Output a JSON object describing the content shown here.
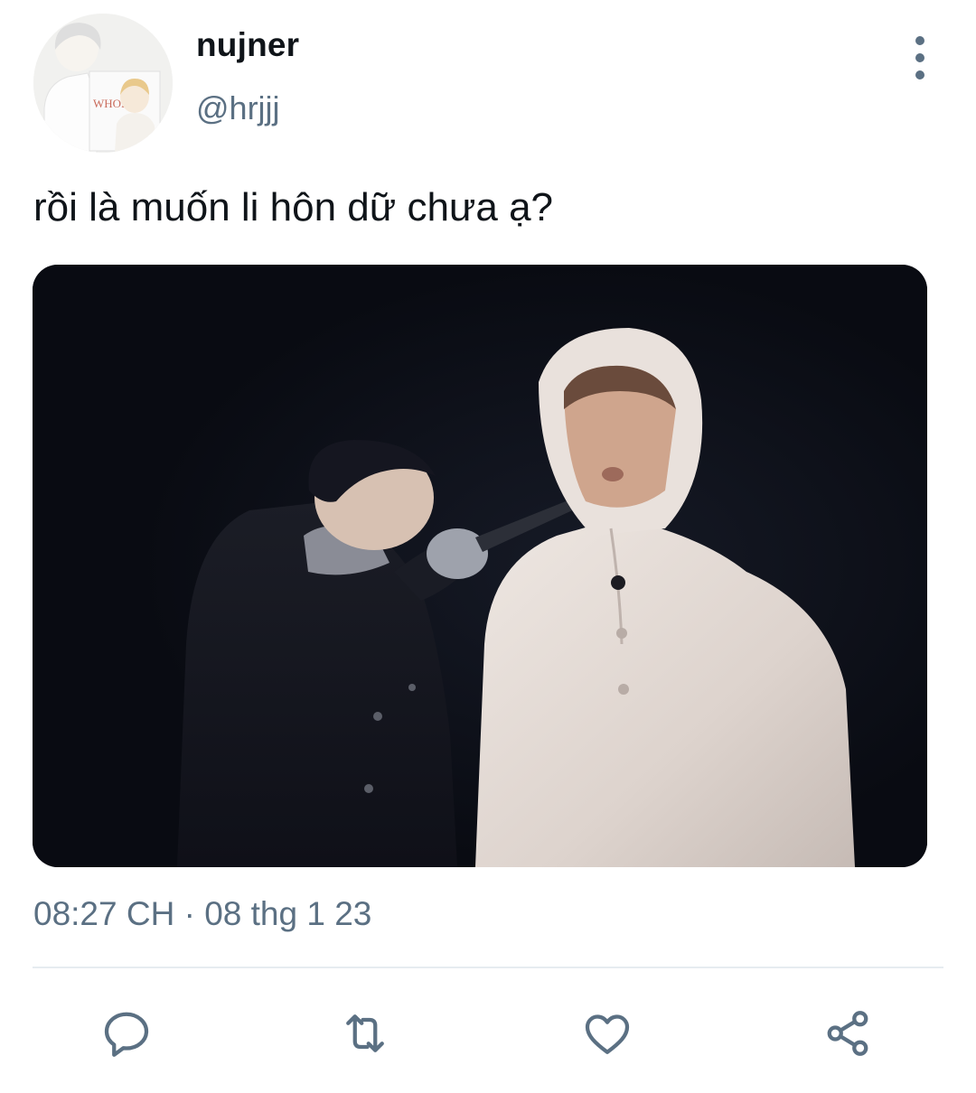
{
  "author": {
    "display_name": "nujner",
    "handle": "@hrjjj",
    "avatar_text": "WHORE"
  },
  "tweet": {
    "text": "rồi là muốn li hôn dữ chưa ạ?",
    "timestamp": "08:27 CH · 08 thg 1 23"
  },
  "actions": {
    "reply_icon": "reply-icon",
    "retweet_icon": "retweet-icon",
    "like_icon": "heart-icon",
    "share_icon": "share-icon"
  },
  "colors": {
    "text_primary": "#0f1419",
    "text_secondary": "#5b7083",
    "divider": "#e6ecf0",
    "media_background": "#0b0d15"
  }
}
